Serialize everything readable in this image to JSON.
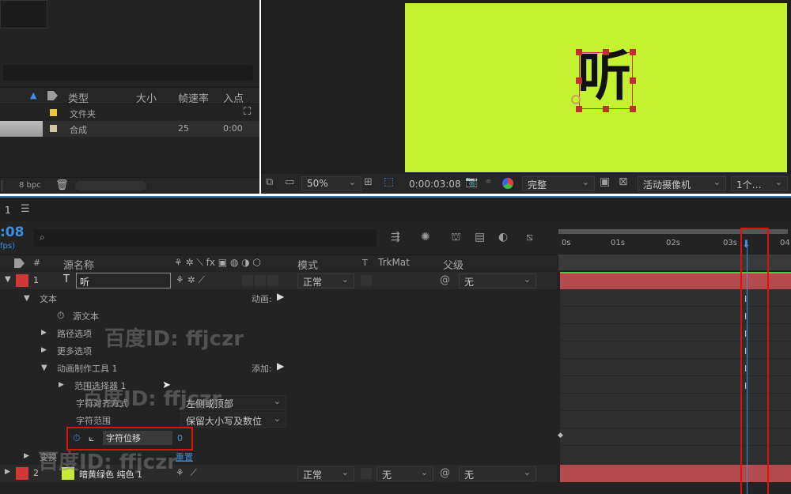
{
  "project": {
    "columns": {
      "type": "类型",
      "size": "大小",
      "fps": "帧速率",
      "in": "入点"
    },
    "rows": [
      {
        "type": "文件夹",
        "size": "",
        "fps": "",
        "in": ""
      },
      {
        "type": "合成",
        "size": "",
        "fps": "25",
        "in": "0:00"
      }
    ],
    "bpc": "8 bpc"
  },
  "viewer": {
    "zoom": "50%",
    "timecode": "0:00:03:08",
    "quality": "完整",
    "camera": "活动摄像机",
    "views": "1个…",
    "glyph": "听",
    "bg_color": "#c5f230"
  },
  "timeline": {
    "comp_tab": "1",
    "time_short": ":08",
    "fps_note": "fps)",
    "search_placeholder": "",
    "headers": {
      "hash": "#",
      "source_name": "源名称",
      "mode": "模式",
      "t": "T",
      "trkmat": "TrkMat",
      "parent": "父级"
    },
    "ruler": [
      "0s",
      "01s",
      "02s",
      "03s",
      "04"
    ],
    "layers": [
      {
        "num": "1",
        "name": "听",
        "mode": "正常",
        "parent": "无"
      },
      {
        "num": "2",
        "name": "暗黄绿色 纯色 1",
        "mode": "正常",
        "trkmat": "无",
        "parent": "无",
        "color": "#c8e838"
      }
    ],
    "props": {
      "text": "文本",
      "animate": "动画:",
      "source_text": "源文本",
      "path_options": "路径选项",
      "more_options": "更多选项",
      "animator": "动画制作工具 1",
      "add": "添加:",
      "range_selector": "范围选择器 1",
      "char_align_label": "字符对齐方式",
      "char_align_value": "左侧或顶部",
      "char_range_label": "字符范围",
      "char_range_value": "保留大小写及数位",
      "char_offset_label": "字符位移",
      "char_offset_value": "0",
      "transform": "变换",
      "reset": "重置"
    }
  },
  "watermark": "百度ID: ffjczr"
}
